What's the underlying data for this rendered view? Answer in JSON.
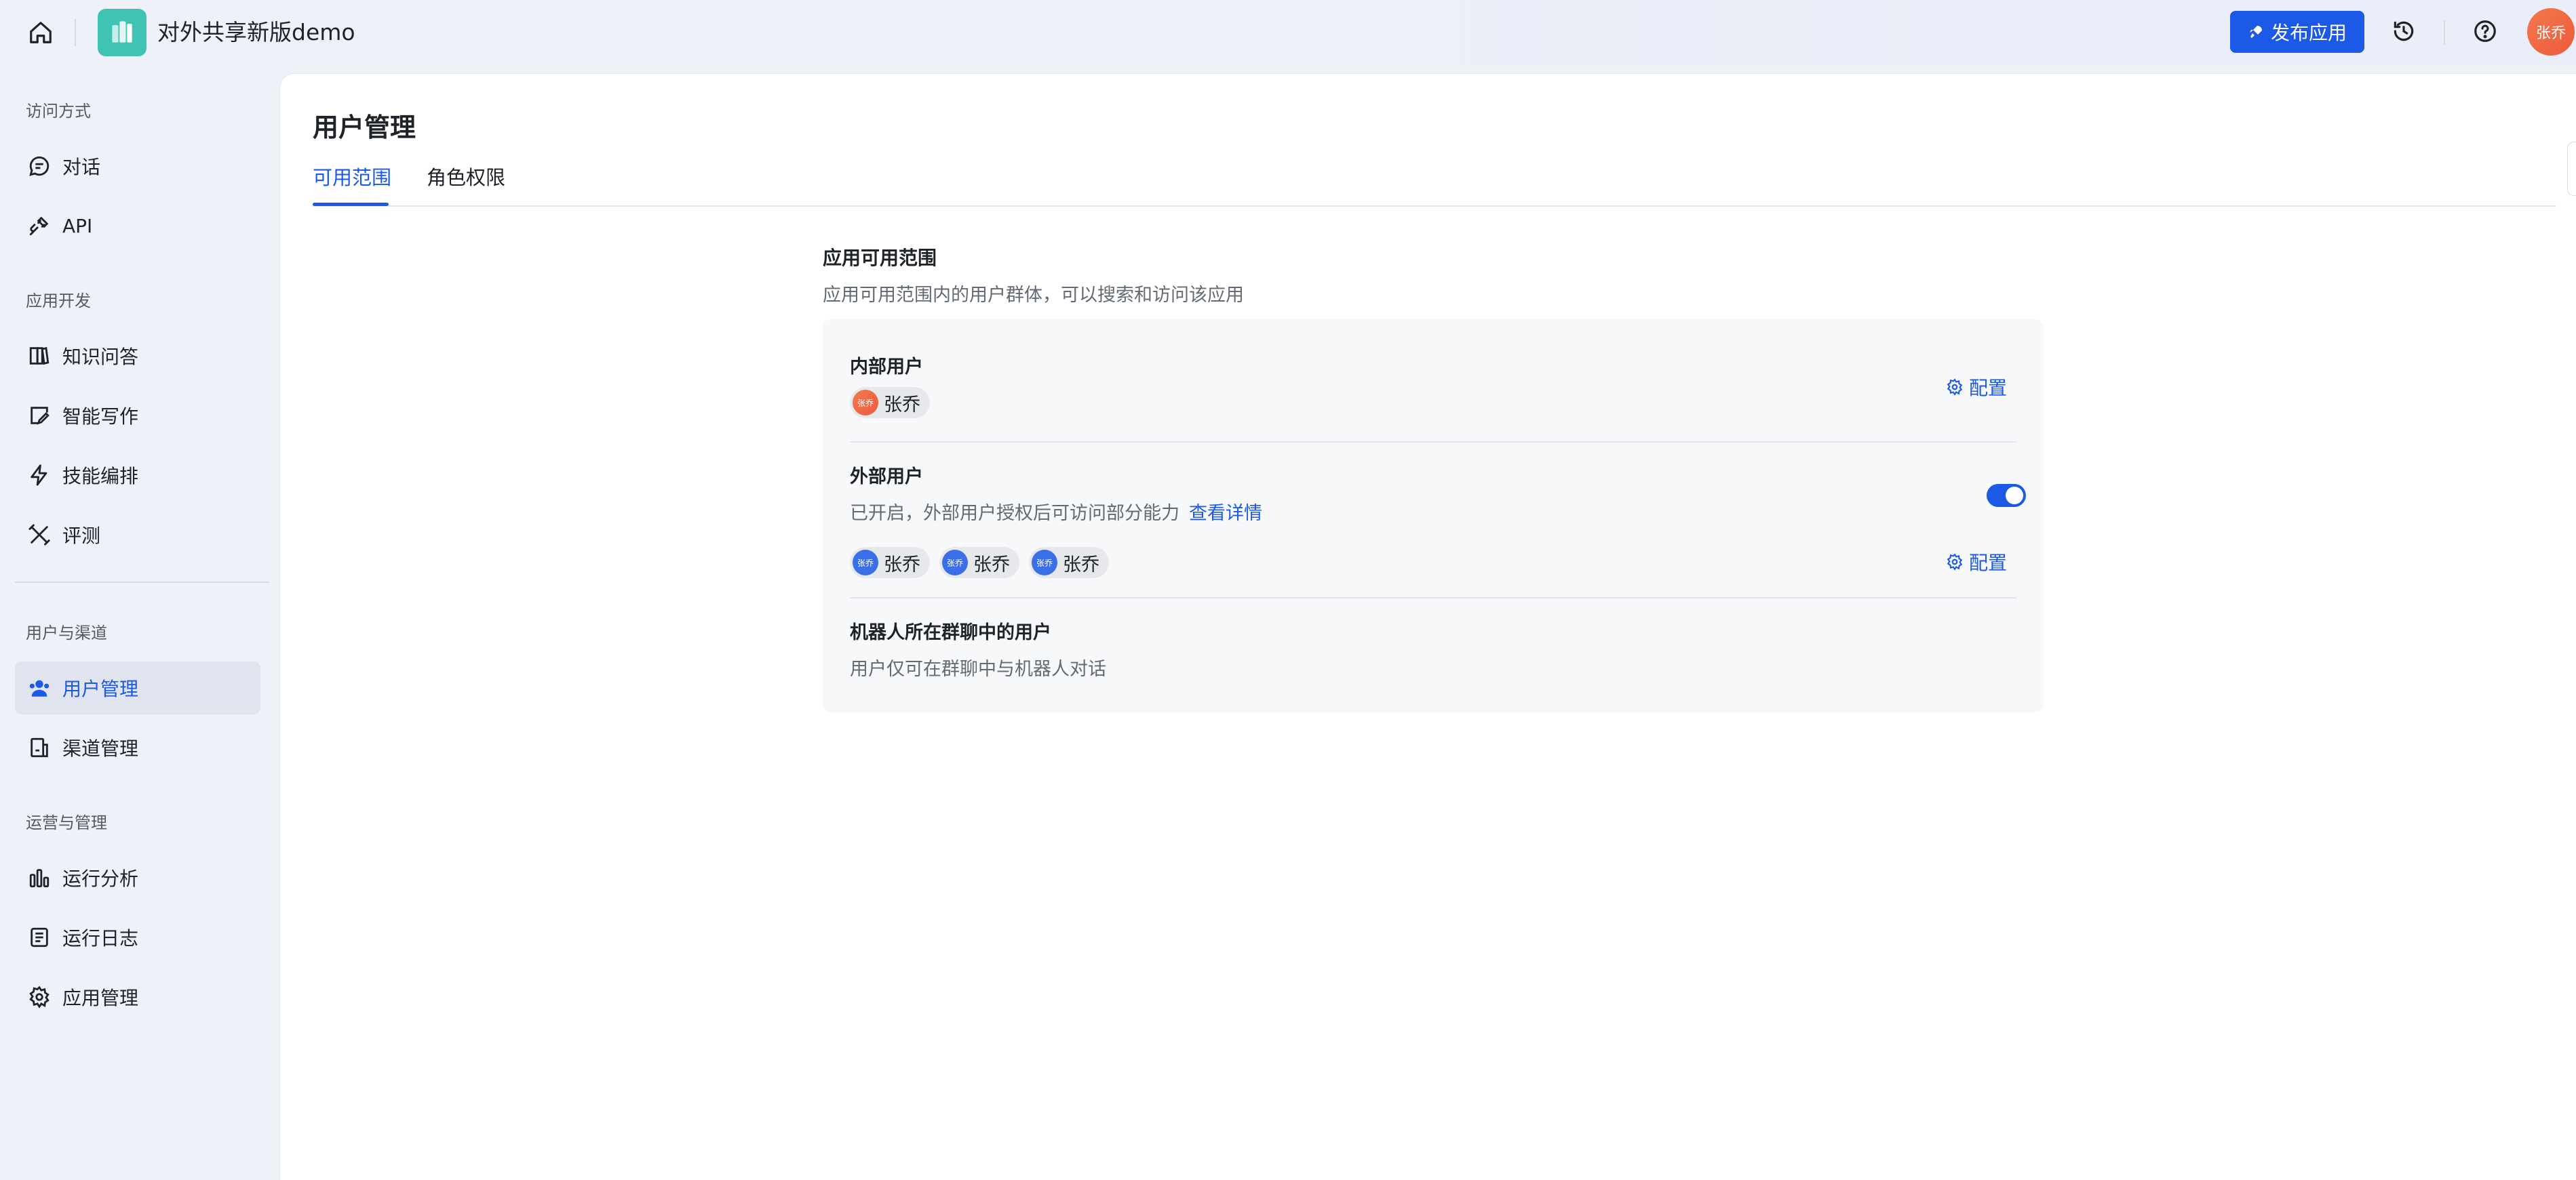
{
  "header": {
    "app_title": "对外共享新版demo",
    "publish_label": "发布应用",
    "user_avatar_text": "张乔",
    "accent": "#1c59e6"
  },
  "sidebar": {
    "sections": [
      {
        "title": "访问方式",
        "items": [
          {
            "label": "对话",
            "icon": "chat-icon"
          },
          {
            "label": "API",
            "icon": "api-plug-icon"
          }
        ]
      },
      {
        "title": "应用开发",
        "items": [
          {
            "label": "知识问答",
            "icon": "book-icon"
          },
          {
            "label": "智能写作",
            "icon": "pen-icon"
          },
          {
            "label": "技能编排",
            "icon": "lightning-icon"
          },
          {
            "label": "评测",
            "icon": "tools-icon"
          }
        ]
      },
      {
        "title": "用户与渠道",
        "items": [
          {
            "label": "用户管理",
            "icon": "users-icon",
            "active": true
          },
          {
            "label": "渠道管理",
            "icon": "channel-icon"
          }
        ]
      },
      {
        "title": "运营与管理",
        "items": [
          {
            "label": "运行分析",
            "icon": "bar-chart-icon"
          },
          {
            "label": "运行日志",
            "icon": "log-icon"
          },
          {
            "label": "应用管理",
            "icon": "gear-icon"
          }
        ]
      }
    ]
  },
  "main": {
    "page_title": "用户管理",
    "tabs": [
      {
        "label": "可用范围",
        "active": true
      },
      {
        "label": "角色权限"
      }
    ],
    "scope": {
      "title": "应用可用范围",
      "description": "应用可用范围内的用户群体，可以搜索和访问该应用",
      "internal": {
        "title": "内部用户",
        "users": [
          {
            "name": "张乔",
            "avatar": "张乔"
          }
        ],
        "config_label": "配置"
      },
      "external": {
        "title": "外部用户",
        "status_text": "已开启，外部用户授权后可访问部分能力",
        "detail_link": "查看详情",
        "enabled": true,
        "users": [
          {
            "name": "张乔",
            "avatar": "张乔"
          },
          {
            "name": "张乔",
            "avatar": "张乔"
          },
          {
            "name": "张乔",
            "avatar": "张乔"
          }
        ],
        "config_label": "配置"
      },
      "bot_group": {
        "title": "机器人所在群聊中的用户",
        "description": "用户仅可在群聊中与机器人对话"
      }
    }
  }
}
